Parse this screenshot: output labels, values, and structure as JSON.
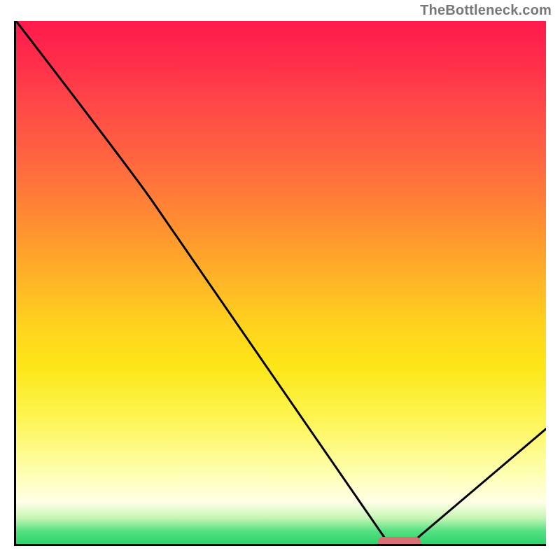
{
  "watermark": "TheBottleneck.com",
  "chart_data": {
    "type": "line",
    "title": "",
    "xlabel": "",
    "ylabel": "",
    "xlim": [
      0,
      100
    ],
    "ylim": [
      0,
      100
    ],
    "x": [
      0,
      22,
      70,
      75,
      100
    ],
    "values": [
      100,
      71,
      0.5,
      0.5,
      22
    ],
    "marker": {
      "x_start": 68,
      "x_end": 76,
      "y": 0.5
    },
    "gradient_stops": [
      {
        "pos": 0,
        "color": "#ff1a4d"
      },
      {
        "pos": 50,
        "color": "#ffd21e"
      },
      {
        "pos": 92,
        "color": "#ffffe6"
      },
      {
        "pos": 100,
        "color": "#2bd46d"
      }
    ]
  }
}
